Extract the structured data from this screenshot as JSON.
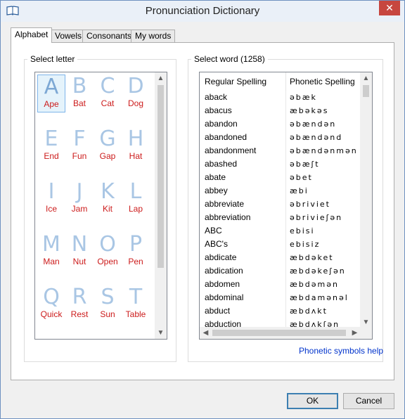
{
  "window": {
    "title": "Pronunciation Dictionary"
  },
  "tabs": [
    {
      "label": "Alphabet",
      "active": true
    },
    {
      "label": "Vowels",
      "active": false
    },
    {
      "label": "Consonants",
      "active": false
    },
    {
      "label": "My words",
      "active": false
    }
  ],
  "letters_group": {
    "label": "Select letter"
  },
  "letters": [
    {
      "letter": "A",
      "word": "Ape",
      "selected": true
    },
    {
      "letter": "B",
      "word": "Bat"
    },
    {
      "letter": "C",
      "word": "Cat"
    },
    {
      "letter": "D",
      "word": "Dog"
    },
    {
      "letter": "E",
      "word": "End"
    },
    {
      "letter": "F",
      "word": "Fun"
    },
    {
      "letter": "G",
      "word": "Gap"
    },
    {
      "letter": "H",
      "word": "Hat"
    },
    {
      "letter": "I",
      "word": "Ice"
    },
    {
      "letter": "J",
      "word": "Jam"
    },
    {
      "letter": "K",
      "word": "Kit"
    },
    {
      "letter": "L",
      "word": "Lap"
    },
    {
      "letter": "M",
      "word": "Man"
    },
    {
      "letter": "N",
      "word": "Nut"
    },
    {
      "letter": "O",
      "word": "Open"
    },
    {
      "letter": "P",
      "word": "Pen"
    },
    {
      "letter": "Q",
      "word": "Quick"
    },
    {
      "letter": "R",
      "word": "Rest"
    },
    {
      "letter": "S",
      "word": "Sun"
    },
    {
      "letter": "T",
      "word": "Table"
    }
  ],
  "word_group": {
    "label": "Select word (1258)"
  },
  "word_list": {
    "columns": [
      "Regular Spelling",
      "Phonetic Spelling"
    ],
    "rows": [
      [
        "aback",
        "əbæk"
      ],
      [
        "abacus",
        "æbəkəs"
      ],
      [
        "abandon",
        "əbændən"
      ],
      [
        "abandoned",
        "əbændənd"
      ],
      [
        "abandonment",
        "əbændənmən"
      ],
      [
        "abashed",
        "əbæʃt"
      ],
      [
        "abate",
        "əbet"
      ],
      [
        "abbey",
        "æbi"
      ],
      [
        "abbreviate",
        "əbriviet"
      ],
      [
        "abbreviation",
        "əbrivieʃən"
      ],
      [
        "ABC",
        "ebisi"
      ],
      [
        "ABC's",
        "ebisiz"
      ],
      [
        "abdicate",
        "æbdəket"
      ],
      [
        "abdication",
        "æbdəkeʃən"
      ],
      [
        "abdomen",
        "æbdəmən"
      ],
      [
        "abdominal",
        "æbdamənəl"
      ],
      [
        "abduct",
        "æbdʌkt"
      ],
      [
        "abduction",
        "æbdʌkʃən"
      ]
    ]
  },
  "help_link": "Phonetic symbols help",
  "buttons": {
    "ok": "OK",
    "cancel": "Cancel"
  },
  "icons": {
    "app": "book-icon",
    "close": "close-icon"
  },
  "colors": {
    "letter": "#a9c6e4",
    "word": "#cc1b1b",
    "link": "#0033cc",
    "close": "#c7463f"
  }
}
